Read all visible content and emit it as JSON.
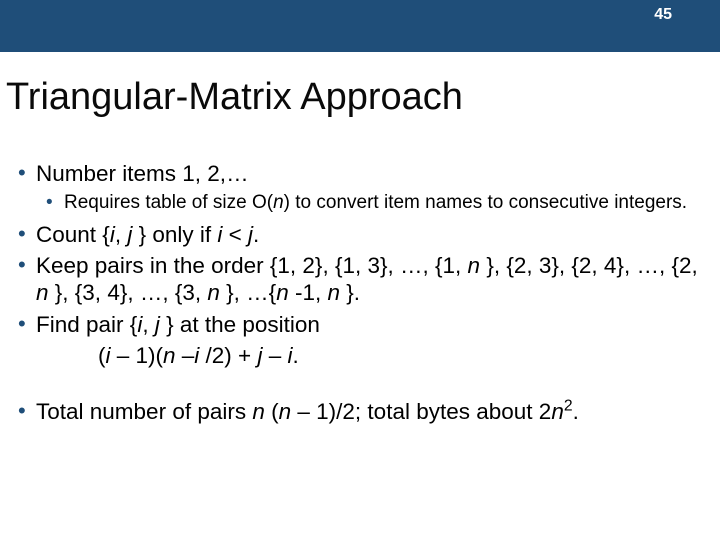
{
  "slide_number": "45",
  "title": "Triangular-Matrix Approach",
  "bullets": {
    "b1": {
      "t1": "Number items 1, 2,…"
    },
    "b1a": {
      "t1": "Requires table of size O(",
      "n": "n",
      "t2": ") to convert item names to consecutive integers."
    },
    "b2": {
      "t1": "Count {",
      "i": "i",
      "c1": ", ",
      "j": "j ",
      "t2": "} only if ",
      "i2": "i ",
      "lt": "< ",
      "j2": "j",
      "dot": "."
    },
    "b3": {
      "t1": "Keep pairs in the order {1, 2}, {1, 3}, …, {1, ",
      "n1": "n ",
      "t2": "}, {2, 3}, {2, 4}, …, {2, ",
      "n2": "n ",
      "t3": "}, {3, 4}, …, {3, ",
      "n3": "n ",
      "t4": "}, …{",
      "n4": "n ",
      "t5": "-1, ",
      "n5": "n ",
      "t6": "}."
    },
    "b4": {
      "t1": "Find pair {",
      "i": "i",
      "c1": ", ",
      "j": "j ",
      "t2": "} at the position"
    },
    "formula": {
      "open": "(",
      "i": "i ",
      "m1": "– 1)(",
      "n": "n ",
      "m2": "–",
      "i2": "i ",
      "m3": "/2) + ",
      "j": "j ",
      "m4": "– ",
      "i3": "i",
      "dot": "."
    },
    "b5": {
      "t1": "Total number of pairs ",
      "n1": "n ",
      "open": "(",
      "n2": "n ",
      "t2": "– 1)/2; total bytes about 2",
      "n3": "n",
      "sq": "2",
      "dot": "."
    }
  }
}
